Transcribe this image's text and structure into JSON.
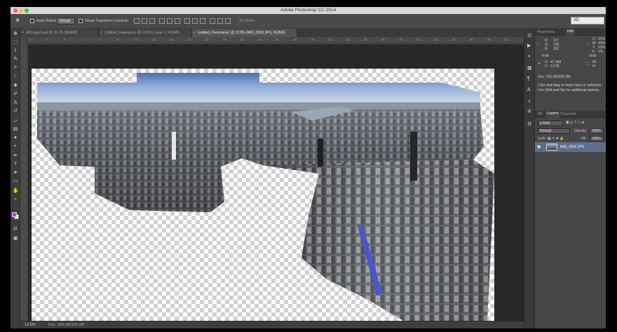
{
  "app": {
    "title": "Adobe Photoshop CC 2014"
  },
  "options_bar": {
    "auto_select_label": "Auto-Select:",
    "auto_select_value": "Group",
    "show_transform_label": "Show Transform Controls",
    "mode_3d_label": "3D Mode:",
    "workspace": "3D"
  },
  "tabs": [
    {
      "label": "AllCroped.psd @ 16.7% (RGB/8)"
    },
    {
      "label": "Untitled_Panorama1 @ 12.5% (Layer 0, RGB/8)"
    },
    {
      "label": "Untitled_Panorama2 @ 12.5% (IMG_0500.JPG, RGB/8)"
    }
  ],
  "ruler_ticks": [
    "-2",
    "0",
    "2",
    "4",
    "6",
    "8",
    "10",
    "12",
    "14",
    "16",
    "18",
    "20",
    "22",
    "24",
    "26",
    "28",
    "30",
    "32",
    "34",
    "36",
    "38",
    "40",
    "42",
    "44",
    "46",
    "48",
    "50",
    "52"
  ],
  "status": {
    "zoom": "12.5%",
    "doc": "Doc: 265.9M/296.3M"
  },
  "info_panel": {
    "tab_properties": "Properties",
    "tab_info": "Info",
    "r_label": "R:",
    "r": "117",
    "g_label": "G:",
    "g": "135",
    "b_label": "B:",
    "b": "162",
    "c_label": "C:",
    "c": "51%",
    "m_label": "M:",
    "m": "40%",
    "y_label": "Y:",
    "y": "21%",
    "k_label": "K:",
    "k": "1%",
    "bit_left": "8-bit",
    "bit_right": "8-bit",
    "x_label": "X:",
    "x": "47.358",
    "yy_label": "Y:",
    "yy": "3.478",
    "w_label": "W:",
    "h_label": "H:",
    "doc": "Doc: 265.9M/296.3M",
    "message": "Click and drag to move layer or selection. Use Shift and Opt for additional options."
  },
  "layers_panel": {
    "tab_3d": "3D",
    "tab_layers": "Layers",
    "tab_channels": "Channels",
    "filter_kind": "ρ Kind",
    "blend_mode": "Normal",
    "opacity_label": "Opacity:",
    "opacity": "100%",
    "lock_label": "Lock:",
    "fill_label": "Fill:",
    "fill": "100%",
    "layers": [
      {
        "name": "IMG_0500.JPG"
      }
    ]
  },
  "colors": {
    "foreground": "#e12fd1",
    "background": "#ffffff",
    "layer_selected": "#5d6f8c"
  },
  "icons": {
    "tools": [
      "move-icon",
      "marquee-icon",
      "lasso-icon",
      "quick-select-icon",
      "crop-icon",
      "eyedropper-icon",
      "healing-icon",
      "brush-icon",
      "clone-stamp-icon",
      "history-brush-icon",
      "eraser-icon",
      "gradient-icon",
      "blur-icon",
      "dodge-icon",
      "pen-icon",
      "type-icon",
      "path-select-icon",
      "rectangle-icon",
      "hand-icon",
      "zoom-icon"
    ]
  }
}
